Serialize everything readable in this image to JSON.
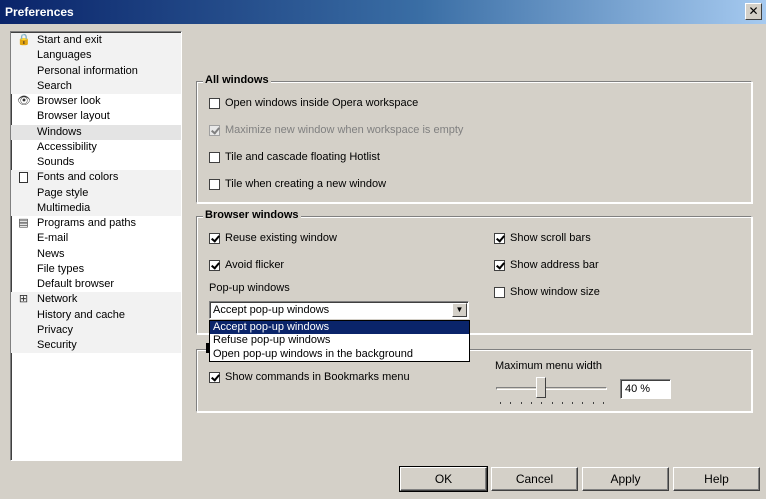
{
  "window": {
    "title": "Preferences",
    "close_label": "✕"
  },
  "sidebar": {
    "groups": [
      {
        "icon": "lock-icon",
        "items": [
          "Start and exit",
          "Languages",
          "Personal information",
          "Search"
        ]
      },
      {
        "icon": "eye-icon",
        "items": [
          "Browser look",
          "Browser layout",
          "Windows",
          "Accessibility",
          "Sounds"
        ]
      },
      {
        "icon": "page-icon",
        "items": [
          "Fonts and colors",
          "Page style",
          "Multimedia"
        ]
      },
      {
        "icon": "program-icon",
        "items": [
          "Programs and paths",
          "E-mail",
          "News",
          "File types",
          "Default browser"
        ]
      },
      {
        "icon": "network-icon",
        "items": [
          "Network",
          "History and cache",
          "Privacy",
          "Security"
        ]
      }
    ],
    "selected": "Windows"
  },
  "all_windows": {
    "title": "All windows",
    "options": [
      {
        "label": "Open windows inside Opera workspace",
        "checked": false,
        "disabled": false
      },
      {
        "label": "Maximize new window when workspace is empty",
        "checked": true,
        "disabled": true
      },
      {
        "label": "Tile and cascade floating Hotlist",
        "checked": false,
        "disabled": false
      },
      {
        "label": "Tile when creating a new window",
        "checked": false,
        "disabled": false
      }
    ]
  },
  "browser_windows": {
    "title": "Browser windows",
    "left_options": [
      {
        "label": "Reuse existing window",
        "checked": true
      },
      {
        "label": "Avoid flicker",
        "checked": true
      }
    ],
    "right_options": [
      {
        "label": "Show scroll bars",
        "checked": true
      },
      {
        "label": "Show address bar",
        "checked": true
      },
      {
        "label": "Show window size",
        "checked": false
      }
    ],
    "popup_label": "Pop-up windows",
    "popup_selected": "Accept pop-up windows",
    "popup_options": [
      "Accept pop-up windows",
      "Refuse pop-up windows",
      "Open pop-up windows in the background"
    ]
  },
  "menus": {
    "show_commands_label": "Show commands in Bookmarks menu",
    "show_commands_checked": true,
    "max_width_label": "Maximum menu width",
    "max_width_value": "40 %",
    "slider_level_percent": 40
  },
  "buttons": {
    "ok": "OK",
    "cancel": "Cancel",
    "apply": "Apply",
    "help": "Help"
  }
}
